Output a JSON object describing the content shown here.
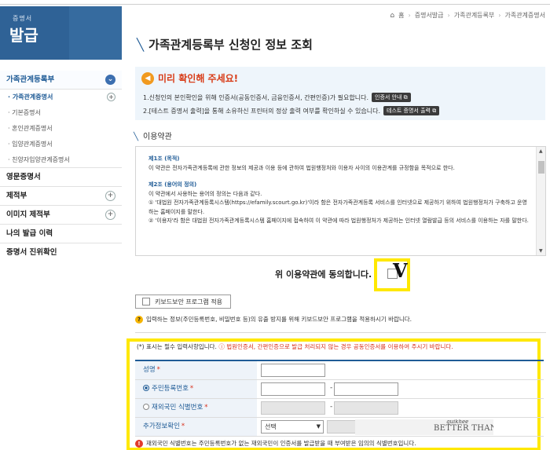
{
  "logo": {
    "line1": "증명서",
    "line2": "발급"
  },
  "sidebar": {
    "groups": [
      {
        "label": "가족관계등록부",
        "icon": "chevron-down-icon",
        "active": true,
        "items": [
          {
            "label": "· 가족관계증명서",
            "active": true,
            "expandable": true
          },
          {
            "label": "· 기본증명서"
          },
          {
            "label": "· 혼인관계증명서"
          },
          {
            "label": "· 입양관계증명서"
          },
          {
            "label": "· 친양자입양관계증명서"
          }
        ]
      },
      {
        "label": "영문증명서"
      },
      {
        "label": "제적부",
        "expandable": true
      },
      {
        "label": "이미지 제적부",
        "expandable": true
      },
      {
        "label": "나의 발급 이력"
      },
      {
        "label": "증명서 진위확인"
      }
    ]
  },
  "breadcrumb": {
    "home": "홈",
    "items": [
      "증명서발급",
      "가족관계등록부",
      "가족관계증명서"
    ]
  },
  "page_title": "가족관계등록부 신청인 정보 조회",
  "notice": {
    "heading": "미리 확인해 주세요!",
    "line1": "1.신청인의 본인확인을 위해 인증서(공동인증서, 금융인증서, 간편인증)가 필요합니다.",
    "line1_button": "인증서 안내",
    "line2": "2.[테스트 증명서 출력]을 통해 소유하신 프린터의 정상 출력 여부를 확인하실 수 있습니다.",
    "line2_button": "테스트 증명서 출력"
  },
  "terms": {
    "section_title": "이용약관",
    "article1_title": "제1조 (목적)",
    "article1_body": "이 약관은 전자가족관계등록에 관한 정보의 제공과 이용 등에 관하여 법원행정처와 이용자 사이의 이용관계를 규정함을 목적으로 한다.",
    "article2_title": "제2조 (용어의 정의)",
    "article2_intro": "이 약관에서 사용하는 용어의 정의는 다음과 같다.",
    "article2_item1": "① '대법원 전자가족관계등록시스템(https://efamily.scourt.go.kr)'이라 함은 전자가족관계등록 서비스를 인터넷으로 제공하기 위하여 법원행정처가 구축하고 운영하는 홈페이지를 말한다.",
    "article2_item2": "② '이용자'라 함은 대법원 전자가족관계등록시스템 홈페이지에 접속하여 이 약관에 따라 법원행정처가 제공하는 인터넷 열람발급 등의 서비스를 이용하는 자를 말한다."
  },
  "agree": {
    "label": "위 이용약관에 동의합니다.",
    "mark": "V"
  },
  "keyboard": {
    "button_label": "키보드보안 프로그램 적용",
    "note": "입력하는 정보(주민등록번호, 비밀번호 등)의 유출 방지를 위해 키보드보안 프로그램을 적용하시기 바랍니다."
  },
  "form": {
    "required_note": "(*) 표시는 필수 입력사항입니다.",
    "required_warning": "법원인증서, 간편인증으로 발급 처리되지 않는 경우 공동인증서를 이용하여 주시기 바랍니다.",
    "name_label": "성명",
    "rrn_label": "주민등록번호",
    "foreigner_label": "재외국민 식별번호",
    "extra_label": "추가정보확인",
    "select_value": "선택",
    "captcha_top": "quikhee",
    "captcha_text": "BETTER THAN USUAL",
    "bottom_note": "재외국민 식별번호는 주민등록번호가 없는 재외국민이 인증서를 발급받을 때 부여받은 임의의 식별번호입니다."
  },
  "colors": {
    "brand": "#1f5b96",
    "highlight": "#ffe800",
    "warning": "#d8301c"
  }
}
